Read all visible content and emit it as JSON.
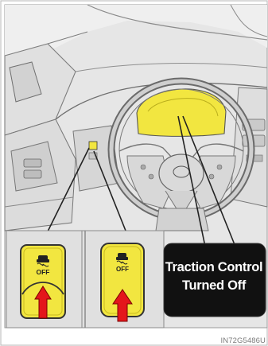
{
  "callout": {
    "display_line1": "Traction Control",
    "display_line2": "Turned Off",
    "button_label_left": "OFF",
    "button_label_right": "OFF"
  },
  "image_code": "IN72G5486U",
  "colors": {
    "background": "#e6e6e6",
    "highlight_yellow": "#f2e640",
    "arrow_red": "#e4161b",
    "display_black": "#111111"
  },
  "icons": [
    "skid-car-icon",
    "press-arrow-icon"
  ]
}
